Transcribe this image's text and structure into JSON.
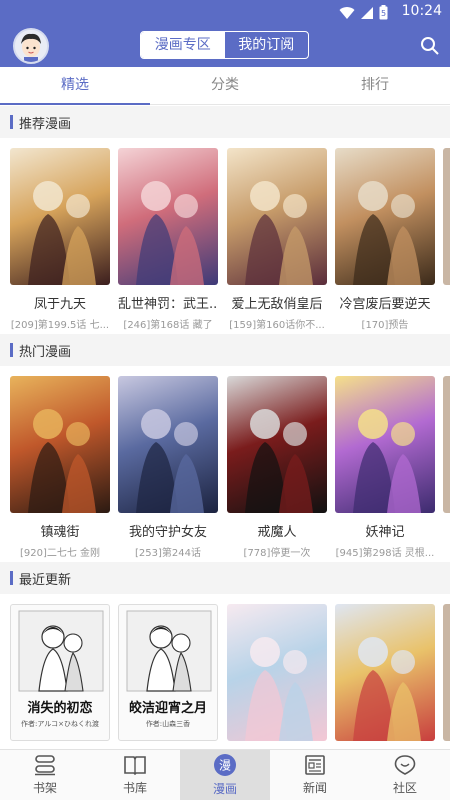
{
  "status_bar": {
    "time": "10:24"
  },
  "header": {
    "segments": [
      "漫画专区",
      "我的订阅"
    ],
    "active_segment": 0
  },
  "tabs": [
    {
      "label": "精选"
    },
    {
      "label": "分类"
    },
    {
      "label": "排行"
    }
  ],
  "sections": [
    {
      "title": "推荐漫画",
      "items": [
        {
          "name": "凤于九天",
          "sub": "[209]第199.5话 七...",
          "colors": [
            "#3b1e1e",
            "#d6a35b",
            "#f2e6cf"
          ]
        },
        {
          "name": "乱世神罚：武王...",
          "sub": "[246]第168话 藏了",
          "colors": [
            "#3d3a78",
            "#d06d7b",
            "#f4d3d6"
          ]
        },
        {
          "name": "爱上无敌俏皇后",
          "sub": "[159]第160话你不...",
          "colors": [
            "#5a2d3b",
            "#c79c6a",
            "#f3e4c9"
          ]
        },
        {
          "name": "冷宫废后要逆天",
          "sub": "[170]预告",
          "colors": [
            "#3b2a1a",
            "#c29060",
            "#e7dcc8"
          ]
        }
      ]
    },
    {
      "title": "热门漫画",
      "items": [
        {
          "name": "镇魂街",
          "sub": "[920]二七七 金刚",
          "colors": [
            "#2b1a12",
            "#c0582b",
            "#e8b35c"
          ]
        },
        {
          "name": "我的守护女友",
          "sub": "[253]第244话",
          "colors": [
            "#1c2340",
            "#5a6aa0",
            "#c8c8e0"
          ]
        },
        {
          "name": "戒魔人",
          "sub": "[778]停更一次",
          "colors": [
            "#111111",
            "#7a1c1c",
            "#d9d9d9"
          ]
        },
        {
          "name": "妖神记",
          "sub": "[945]第298话 灵根...",
          "colors": [
            "#3c2b6e",
            "#b26ad1",
            "#f5e08a"
          ]
        }
      ]
    },
    {
      "title": "最近更新",
      "items": [
        {
          "name": "消失的初恋",
          "sub": "作者:アルコ×ひねくれ渡",
          "kind": "book"
        },
        {
          "name": "皎洁迎宵之月",
          "sub": "作者:山森三香",
          "kind": "book"
        },
        {
          "name": "",
          "sub": "",
          "colors": [
            "#f3c7d4",
            "#b8d3e8",
            "#f7eaf0"
          ]
        },
        {
          "name": "",
          "sub": "",
          "colors": [
            "#c83e3e",
            "#e9c26a",
            "#dfe6f2"
          ]
        }
      ]
    }
  ],
  "bottom_nav": [
    {
      "label": "书架",
      "icon": "bookshelf-icon"
    },
    {
      "label": "书库",
      "icon": "book-library-icon"
    },
    {
      "label": "漫画",
      "icon": "manga-icon",
      "badge": "漫"
    },
    {
      "label": "新闻",
      "icon": "news-icon"
    },
    {
      "label": "社区",
      "icon": "community-icon"
    }
  ],
  "accent_color": "#5b6cc5"
}
